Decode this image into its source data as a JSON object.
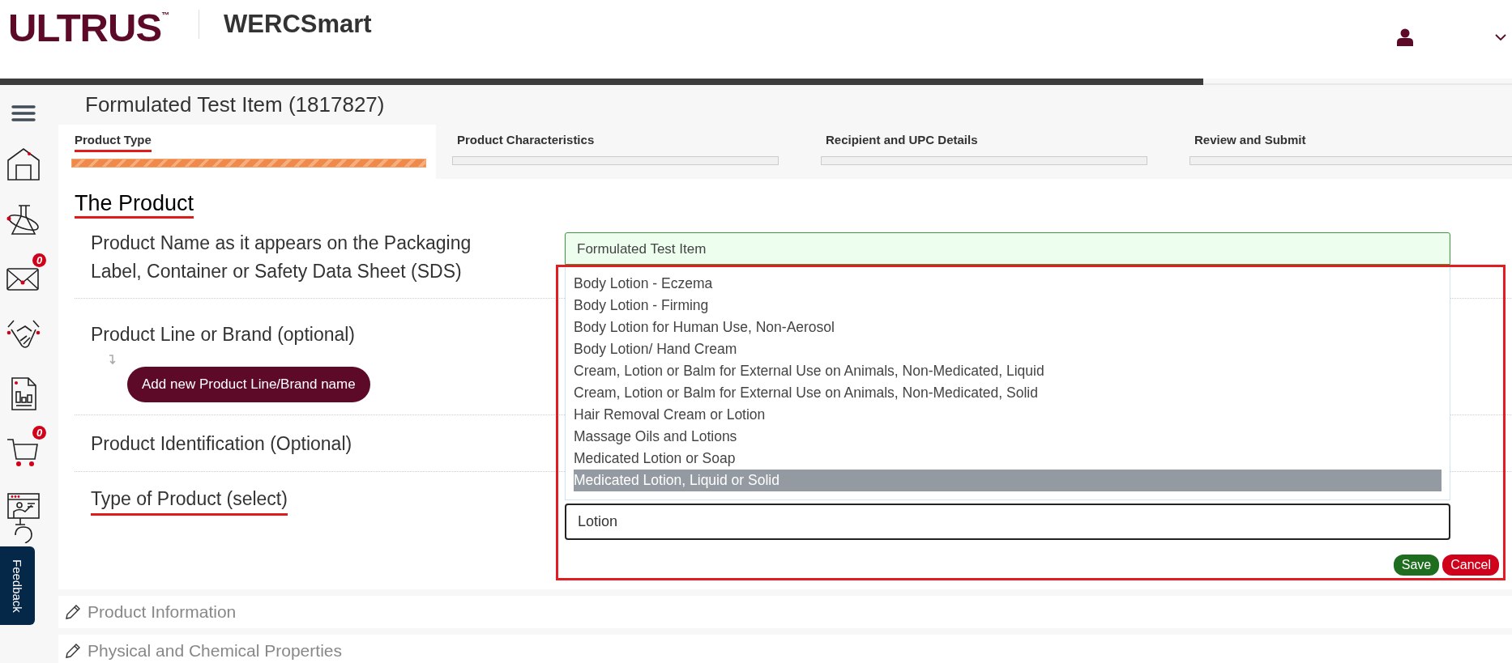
{
  "header": {
    "logo": "ULTRUS",
    "logo_mark": "™",
    "app_name": "WERCSmart"
  },
  "sidebar": {
    "items": [
      {
        "kind": "menu"
      },
      {
        "kind": "home"
      },
      {
        "kind": "flask"
      },
      {
        "kind": "mail",
        "badge": "0"
      },
      {
        "kind": "handshake"
      },
      {
        "kind": "report"
      },
      {
        "kind": "cart",
        "badge": "0"
      },
      {
        "kind": "presentation"
      },
      {
        "kind": "help"
      }
    ]
  },
  "feedback": "Feedback",
  "page_title": "Formulated Test Item (1817827)",
  "steps": [
    {
      "label": "Product Type",
      "selected": true,
      "annotated": true
    },
    {
      "label": "Product Characteristics",
      "selected": false,
      "annotated": false
    },
    {
      "label": "Recipient and UPC Details",
      "selected": false,
      "annotated": false
    },
    {
      "label": "Review and Submit",
      "selected": false,
      "annotated": false
    }
  ],
  "section": {
    "title": "The Product",
    "annotated": true,
    "fields": [
      {
        "label": "Product Name as it appears on the Packaging Label, Container or Safety Data Sheet (SDS)",
        "annotated": false
      },
      {
        "label": "Product Line or Brand (optional)",
        "annotated": false,
        "button": "Add new Product Line/Brand name"
      },
      {
        "label": "Product Identification (Optional)",
        "annotated": false
      },
      {
        "label": "Type of Product (select)",
        "annotated": true
      }
    ]
  },
  "editor": {
    "value": "Formulated Test Item",
    "annotated": true,
    "options": [
      {
        "label": "Body Lotion - Eczema",
        "selected": false
      },
      {
        "label": "Body Lotion - Firming",
        "selected": false
      },
      {
        "label": "Body Lotion for Human Use, Non-Aerosol",
        "selected": false
      },
      {
        "label": "Body Lotion/ Hand Cream",
        "selected": false
      },
      {
        "label": "Cream, Lotion or Balm for External Use on Animals, Non-Medicated, Liquid",
        "selected": false
      },
      {
        "label": "Cream, Lotion or Balm for External Use on Animals, Non-Medicated, Solid",
        "selected": false
      },
      {
        "label": "Hair Removal Cream or Lotion",
        "selected": false
      },
      {
        "label": "Massage Oils and Lotions",
        "selected": false
      },
      {
        "label": "Medicated Lotion or Soap",
        "selected": false
      },
      {
        "label": "Medicated Lotion, Liquid or Solid",
        "selected": true
      }
    ],
    "search": "Lotion",
    "buttons": [
      {
        "label": "Save",
        "kind": "save"
      },
      {
        "label": "Cancel",
        "kind": "cancel"
      }
    ]
  },
  "collapsed_sections": [
    "Product Information",
    "Physical and Chemical Properties"
  ]
}
